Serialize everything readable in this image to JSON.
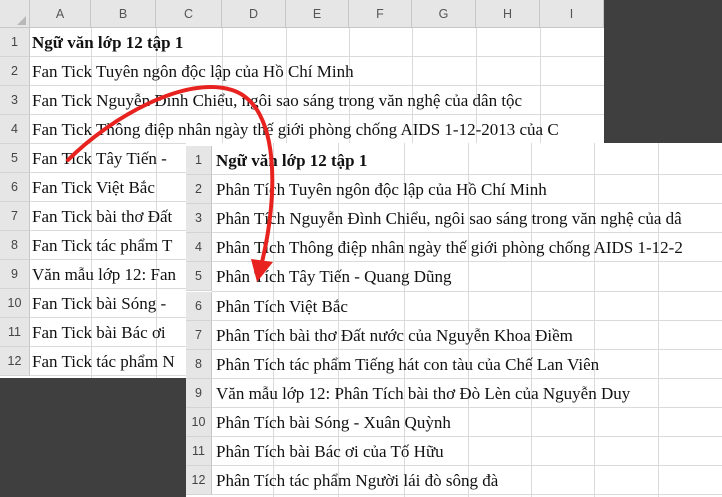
{
  "back_sheet": {
    "columns": [
      "A",
      "B",
      "C",
      "D",
      "E",
      "F",
      "G",
      "H",
      "I"
    ],
    "rows": [
      {
        "num": "1",
        "text": "Ngữ văn lớp 12 tập 1",
        "bold": true
      },
      {
        "num": "2",
        "text": "Fan Tick Tuyên ngôn độc lập của Hồ Chí Minh",
        "bold": false
      },
      {
        "num": "3",
        "text": "Fan Tick Nguyễn Đình Chiểu, ngôi sao sáng trong văn nghệ của dân tộc",
        "bold": false
      },
      {
        "num": "4",
        "text": "Fan Tick Thông điệp nhân ngày thế giới phòng chống AIDS 1-12-2013 của C",
        "bold": false
      },
      {
        "num": "5",
        "text": "Fan Tick Tây Tiến -",
        "bold": false
      },
      {
        "num": "6",
        "text": "Fan Tick Việt Bắc",
        "bold": false
      },
      {
        "num": "7",
        "text": "Fan Tick bài thơ Đất",
        "bold": false
      },
      {
        "num": "8",
        "text": "Fan Tick tác phẩm T",
        "bold": false
      },
      {
        "num": "9",
        "text": "Văn mẫu lớp 12: Fan",
        "bold": false
      },
      {
        "num": "10",
        "text": "Fan Tick bài Sóng -",
        "bold": false
      },
      {
        "num": "11",
        "text": "Fan Tick bài Bác ơi",
        "bold": false
      },
      {
        "num": "12",
        "text": "Fan Tick tác phẩm N",
        "bold": false
      }
    ]
  },
  "front_sheet": {
    "rows": [
      {
        "num": "1",
        "text": "Ngữ văn lớp 12 tập 1",
        "bold": true
      },
      {
        "num": "2",
        "text": "Phân Tích Tuyên ngôn độc lập của Hồ Chí Minh",
        "bold": false
      },
      {
        "num": "3",
        "text": "Phân Tích Nguyễn Đình Chiểu, ngôi sao sáng trong văn nghệ của dâ",
        "bold": false
      },
      {
        "num": "4",
        "text": "Phân Tích Thông điệp nhân ngày thế giới phòng chống AIDS 1-12-2",
        "bold": false
      },
      {
        "num": "5",
        "text": "Phân Tích Tây Tiến - Quang Dũng",
        "bold": false
      },
      {
        "num": "6",
        "text": "Phân Tích Việt Bắc",
        "bold": false
      },
      {
        "num": "7",
        "text": "Phân Tích bài thơ Đất nước của Nguyễn Khoa Điềm",
        "bold": false
      },
      {
        "num": "8",
        "text": "Phân Tích tác phẩm Tiếng hát con tàu của Chế Lan Viên",
        "bold": false
      },
      {
        "num": "9",
        "text": "Văn mẫu lớp 12: Phân Tích bài thơ Đò Lèn của Nguyễn Duy",
        "bold": false
      },
      {
        "num": "10",
        "text": "Phân Tích bài Sóng - Xuân Quỳnh",
        "bold": false
      },
      {
        "num": "11",
        "text": "Phân Tích bài Bác ơi của Tố Hữu",
        "bold": false
      },
      {
        "num": "12",
        "text": "Phân Tích tác phẩm Người lái đò sông đà",
        "bold": false
      }
    ]
  },
  "arrow": {
    "color": "#e8231f"
  }
}
